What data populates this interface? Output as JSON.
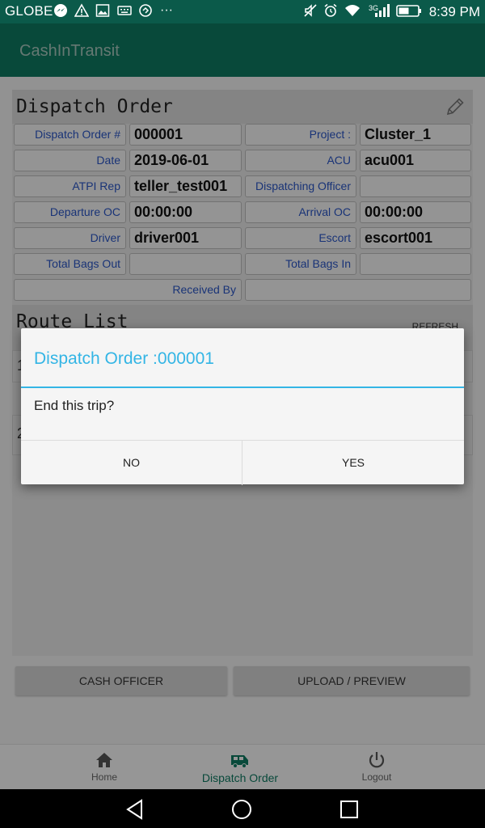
{
  "status_bar": {
    "carrier": "GLOBE",
    "more": "···",
    "network": "3G",
    "time": "8:39 PM",
    "icons": [
      "messenger-icon",
      "warning-icon",
      "image-icon",
      "keyboard-icon",
      "chat-icon",
      "mute-icon",
      "alarm-icon",
      "wifi-icon",
      "signal-icon",
      "battery-icon"
    ]
  },
  "app": {
    "title": "CashInTransit",
    "accent_color": "#0e7a62",
    "dialog_accent": "#33b5e5"
  },
  "dispatch": {
    "header": "Dispatch Order",
    "rows": [
      {
        "l1": "Dispatch Order #",
        "v1": "000001",
        "l2": "Project :",
        "v2": "Cluster_1"
      },
      {
        "l1": "Date",
        "v1": "2019-06-01",
        "l2": "ACU",
        "v2": "acu001"
      },
      {
        "l1": "ATPI Rep",
        "v1": "teller_test001",
        "l2": "Dispatching Officer",
        "v2": ""
      },
      {
        "l1": "Departure OC",
        "v1": "00:00:00",
        "l2": "Arrival OC",
        "v2": "00:00:00"
      },
      {
        "l1": "Driver",
        "v1": "driver001",
        "l2": "Escort",
        "v2": "escort001"
      },
      {
        "l1": "Total Bags Out",
        "v1": "",
        "l2": "Total Bags In",
        "v2": ""
      }
    ],
    "received_by_label": "Received By",
    "received_by_value": ""
  },
  "route_list": {
    "header": "Route List",
    "refresh_label": "REFRESH",
    "items": [
      "1",
      "2"
    ]
  },
  "buttons": {
    "cash_officer": "CASH OFFICER",
    "upload_preview": "UPLOAD / PREVIEW"
  },
  "bottom_nav": {
    "home": "Home",
    "dispatch_order": "Dispatch Order",
    "logout": "Logout",
    "active": "dispatch_order"
  },
  "dialog": {
    "title": "Dispatch Order :000001",
    "message": "End this trip?",
    "no": "NO",
    "yes": "YES"
  }
}
